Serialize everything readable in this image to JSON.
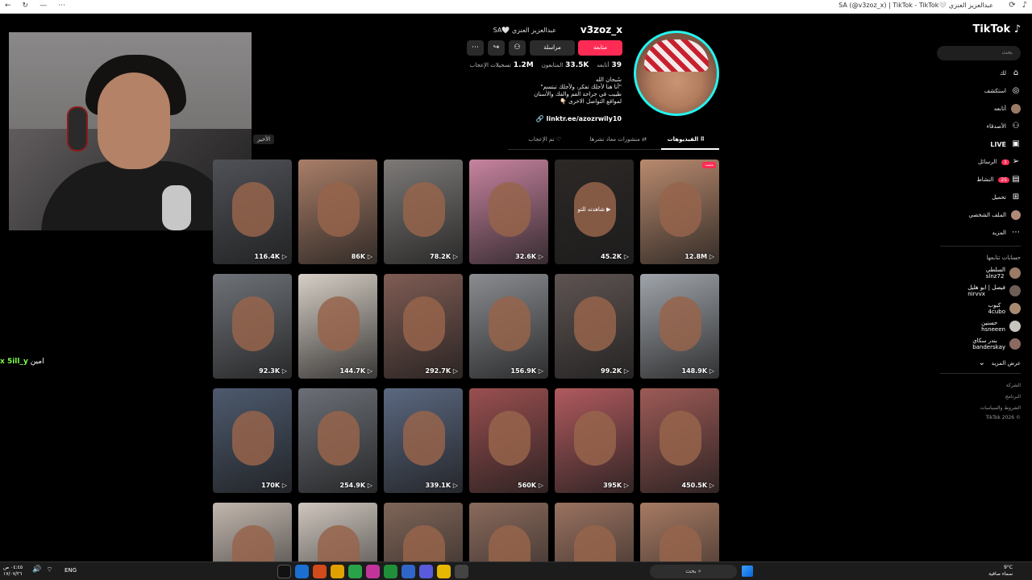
{
  "browser": {
    "tab_title": "عبدالعزيز العنزي 🤍SA (@v3zoz_x) | TikTok - TikTok"
  },
  "overlay": {
    "side_note": "الأخير",
    "chat_name": "x 5ill_y",
    "chat_text": "امين"
  },
  "sidebar": {
    "logo": "TikTok",
    "search_placeholder": "بحث",
    "nav": [
      {
        "label": "لك",
        "icon": "home-icon"
      },
      {
        "label": "استكشف",
        "icon": "compass-icon"
      },
      {
        "label": "أتابعه",
        "icon": "following-avatar-icon"
      },
      {
        "label": "الأصدقاء",
        "icon": "friends-icon"
      },
      {
        "label": "LIVE",
        "icon": "live-icon"
      },
      {
        "label": "الرسائل",
        "icon": "messages-icon",
        "badge": "1"
      },
      {
        "label": "النشاط",
        "icon": "activity-icon",
        "badge": "25"
      },
      {
        "label": "تحميل",
        "icon": "upload-icon"
      },
      {
        "label": "الملف الشخصي",
        "icon": "profile-icon"
      },
      {
        "label": "المزيد",
        "icon": "more-icon"
      }
    ],
    "following_title": "حسابات تتابعها",
    "following": [
      {
        "name": "السلطي",
        "handle": "slnz72"
      },
      {
        "name": "فيصل | ابو هليل",
        "handle": "nirvvx"
      },
      {
        "name": "كيوب",
        "handle": "4cubo"
      },
      {
        "name": "حسنين",
        "handle": "hsneeen"
      },
      {
        "name": "بندر سكاي",
        "handle": "banderskay"
      }
    ],
    "show_more": "عرض المزيد",
    "footer": [
      "الشركة",
      "البرنامج",
      "الشروط والسياسات",
      "© 2026 TikTok"
    ]
  },
  "profile": {
    "username": "v3zoz_x",
    "nickname": "عبدالعزيز العنزي 🤍SA",
    "follow_label": "متابعة",
    "message_label": "مراسلة",
    "stats": [
      {
        "value": "39",
        "label": "أتابعه"
      },
      {
        "value": "33.5K",
        "label": "المتابعون"
      },
      {
        "value": "1.2M",
        "label": "تسجيلات الإعجاب"
      }
    ],
    "bio": [
      "سُبحان الله",
      "\"أنا هنا لأجلك تفكر، ولأجلك تبتسم\"",
      "طبيب في جراحة الفم والفك والأسنان",
      "لمواقع التواصل الاخرى 👇🏻"
    ],
    "link": "linktr.ee/azozrwily10"
  },
  "tabs": [
    {
      "label": "الفيديوهات",
      "active": true
    },
    {
      "label": "منشورات معاد نشرها",
      "active": false
    },
    {
      "label": "تم الإعجاب",
      "active": false
    }
  ],
  "videos": [
    {
      "views": "12.8M",
      "pinned": "مثبت",
      "color": "#b98a6e"
    },
    {
      "views": "45.2K",
      "overlay": "▶ شاهدته للتو",
      "color": "#2c2826"
    },
    {
      "views": "32.6K",
      "color": "#c7839f"
    },
    {
      "views": "78.2K",
      "color": "#7d7a78"
    },
    {
      "views": "86K",
      "color": "#a97e68"
    },
    {
      "views": "116.4K",
      "color": "#4f5157"
    },
    {
      "views": "148.9K",
      "color": "#9fa4aa"
    },
    {
      "views": "99.2K",
      "color": "#5e5452"
    },
    {
      "views": "156.9K",
      "color": "#8a8c90"
    },
    {
      "views": "292.7K",
      "color": "#7f5c54"
    },
    {
      "views": "144.7K",
      "color": "#d7cfc6"
    },
    {
      "views": "92.3K",
      "color": "#6e7278"
    },
    {
      "views": "450.5K",
      "color": "#9d5a56"
    },
    {
      "views": "395K",
      "color": "#b05a5e"
    },
    {
      "views": "560K",
      "color": "#9a4f50"
    },
    {
      "views": "339.1K",
      "color": "#5b6880"
    },
    {
      "views": "254.9K",
      "color": "#6b6f76"
    },
    {
      "views": "170K",
      "color": "#4d5a6e"
    },
    {
      "views": "",
      "color": "#a77a63"
    },
    {
      "views": "",
      "color": "#9a7260"
    },
    {
      "views": "",
      "color": "#8a6a5c"
    },
    {
      "views": "",
      "color": "#7f6558"
    },
    {
      "views": "",
      "color": "#cfc6be"
    },
    {
      "views": "",
      "color": "#c2b7ae"
    }
  ],
  "taskbar": {
    "lang": "ENG",
    "time": "٠٤:٤٥ ص",
    "date": "١٧/٠٧/٢٦",
    "search": "بحث",
    "weather_temp": "9°C",
    "weather_text": "سماء صافية"
  }
}
